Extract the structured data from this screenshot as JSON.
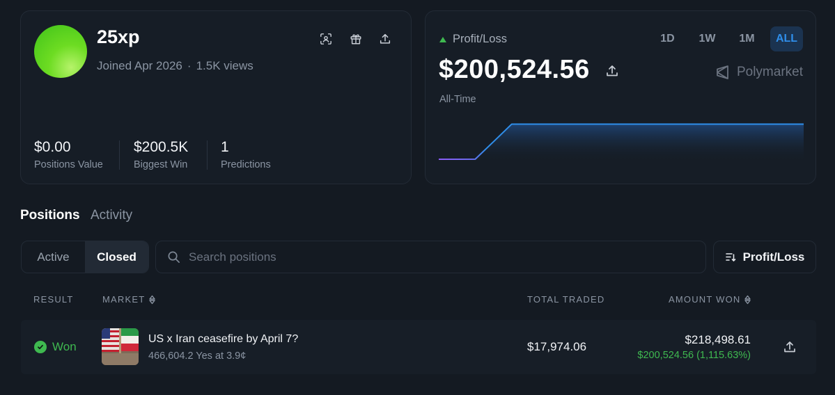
{
  "profile": {
    "username": "25xp",
    "joined": "Joined Apr 2026",
    "separator": "·",
    "views": "1.5K views",
    "icons": [
      "scan-icon",
      "gift-icon",
      "share-icon"
    ],
    "stats": [
      {
        "value": "$0.00",
        "label": "Positions Value"
      },
      {
        "value": "$200.5K",
        "label": "Biggest Win"
      },
      {
        "value": "1",
        "label": "Predictions"
      }
    ]
  },
  "pnl": {
    "label": "Profit/Loss",
    "value": "$200,524.56",
    "period": "All-Time",
    "brand": "Polymarket",
    "ranges": [
      "1D",
      "1W",
      "1M",
      "ALL"
    ],
    "active_range": "ALL",
    "colors": {
      "line_start": "#8b5cf6",
      "line_end": "#2f8eea",
      "accent_up": "#3fb950"
    }
  },
  "chart_data": {
    "type": "area",
    "x": [
      0,
      1,
      2,
      3,
      4,
      5,
      6,
      7,
      8,
      9,
      10,
      11,
      12,
      13,
      14,
      15,
      16,
      17,
      18,
      19,
      20
    ],
    "y": [
      0,
      0,
      500,
      100000,
      200524.56,
      200524.56,
      200524.56,
      200524.56,
      200524.56,
      200524.56,
      200524.56,
      200524.56,
      200524.56,
      200524.56,
      200524.56,
      200524.56,
      200524.56,
      200524.56,
      200524.56,
      200524.56,
      200524.56
    ],
    "ylim": [
      0,
      240000
    ],
    "grid": false,
    "legend": "none"
  },
  "tabs": {
    "positions": "Positions",
    "activity": "Activity"
  },
  "filters": {
    "active": "Active",
    "closed": "Closed",
    "selected": "Closed",
    "search_placeholder": "Search positions",
    "sort_label": "Profit/Loss"
  },
  "table": {
    "headers": {
      "result": "RESULT",
      "market": "MARKET",
      "total_traded": "TOTAL TRADED",
      "amount_won": "AMOUNT WON"
    },
    "rows": [
      {
        "result": "Won",
        "title": "US x Iran ceasefire by April 7?",
        "subtitle": "466,604.2 Yes at 3.9¢",
        "total_traded": "$17,974.06",
        "amount_won": "$218,498.61",
        "pnl": "$200,524.56 (1,115.63%)"
      }
    ]
  }
}
